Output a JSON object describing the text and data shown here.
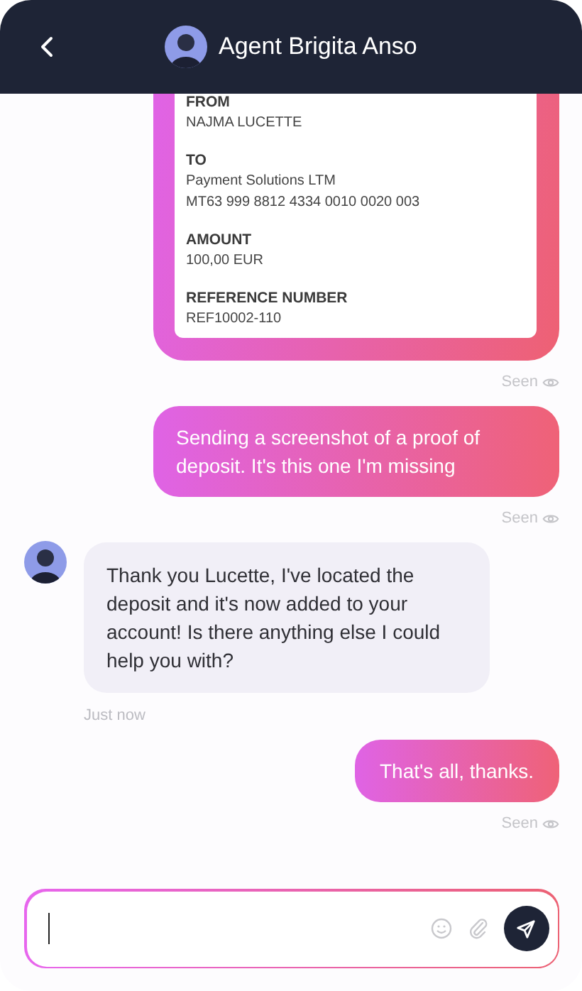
{
  "header": {
    "title": "Agent Brigita Anso"
  },
  "messages": [
    {
      "kind": "receipt",
      "fields": [
        {
          "label": "FROM",
          "lines": [
            "NAJMA LUCETTE"
          ]
        },
        {
          "label": "TO",
          "lines": [
            "Payment Solutions LTM",
            "MT63 999 8812 4334 0010 0020 003"
          ]
        },
        {
          "label": "AMOUNT",
          "lines": [
            "100,00 EUR"
          ]
        },
        {
          "label": "REFERENCE NUMBER",
          "lines": [
            "REF10002-110"
          ]
        }
      ],
      "status": "Seen"
    },
    {
      "kind": "outgoing",
      "text": "Sending a screenshot of a proof of deposit. It's this one I'm missing",
      "status": "Seen"
    },
    {
      "kind": "incoming",
      "text": "Thank you Lucette, I've located the deposit and it's now added to your account! Is there anything else I could help you with?",
      "time": "Just now"
    },
    {
      "kind": "outgoing",
      "text": "That's all, thanks.",
      "status": "Seen"
    }
  ]
}
